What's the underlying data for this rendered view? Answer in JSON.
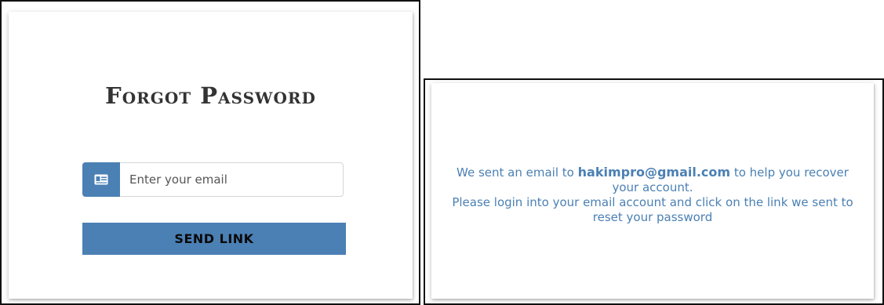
{
  "forgot_panel": {
    "title": "Forgot Password",
    "email_placeholder": "Enter your email",
    "email_value": "",
    "send_button_label": "SEND LINK",
    "icon": "id-card-icon"
  },
  "confirmation_panel": {
    "prefix": "We sent an email to",
    "email": "hakimpro@gmail.com",
    "suffix": "to help you recover your account.",
    "instruction": "Please login into your email account and click on the link we sent to reset your password"
  },
  "colors": {
    "accent": "#4b80b4",
    "title_text": "#333333",
    "frame_border": "#111111"
  }
}
